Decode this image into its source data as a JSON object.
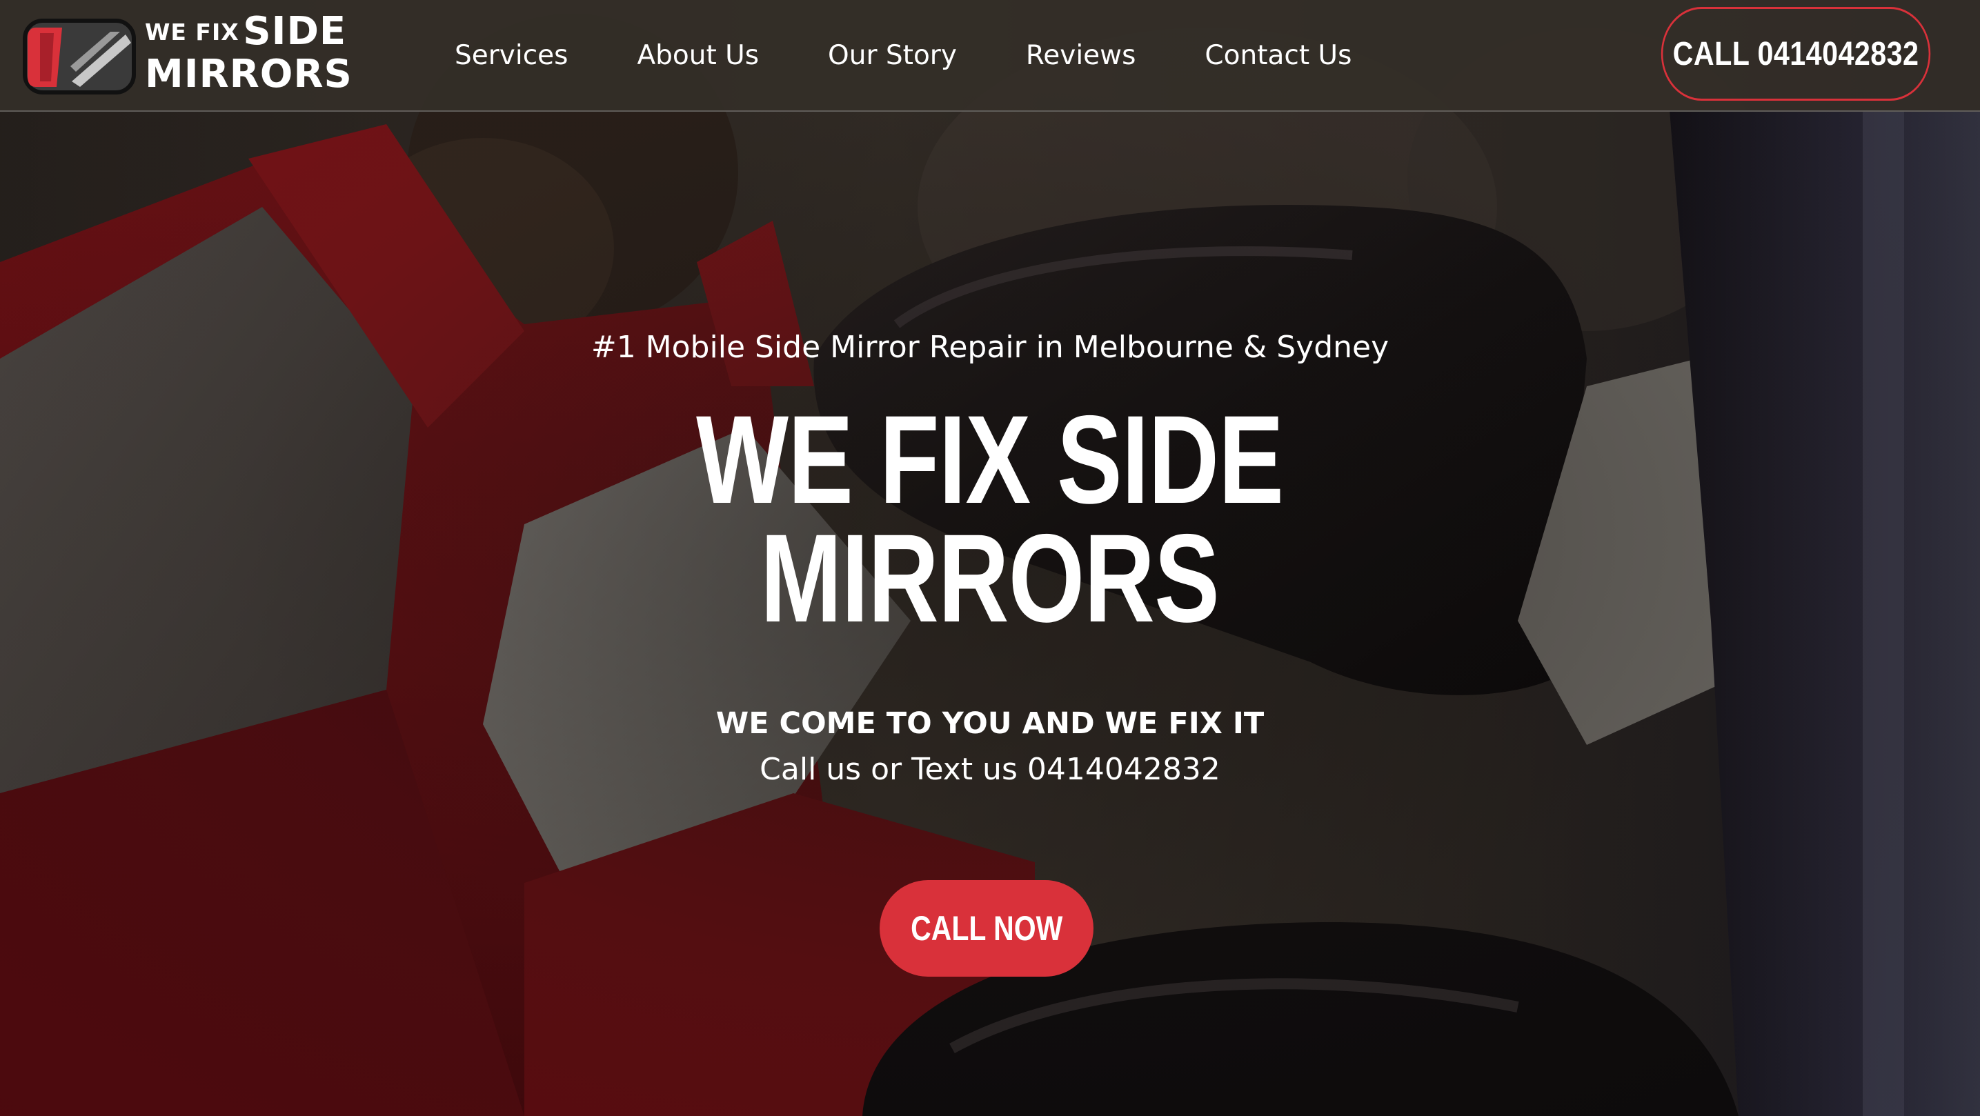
{
  "brand": {
    "logo_small": "WE FIX",
    "logo_big_1": "SIDE",
    "logo_big_2": "MIRRORS",
    "accent_color": "#d9313a"
  },
  "nav": {
    "items": [
      {
        "label": "Services"
      },
      {
        "label": "About Us"
      },
      {
        "label": "Our Story"
      },
      {
        "label": "Reviews"
      },
      {
        "label": "Contact Us"
      }
    ]
  },
  "header": {
    "call_label": "CALL 0414042832"
  },
  "hero": {
    "tagline": "#1 Mobile Side Mirror Repair in Melbourne & Sydney",
    "title_line1": "WE FIX SIDE",
    "title_line2": "MIRRORS",
    "subhead": "WE COME TO YOU AND WE FIX IT",
    "call_text": "Call us or Text us 0414042832",
    "cta_label": "CALL NOW"
  }
}
